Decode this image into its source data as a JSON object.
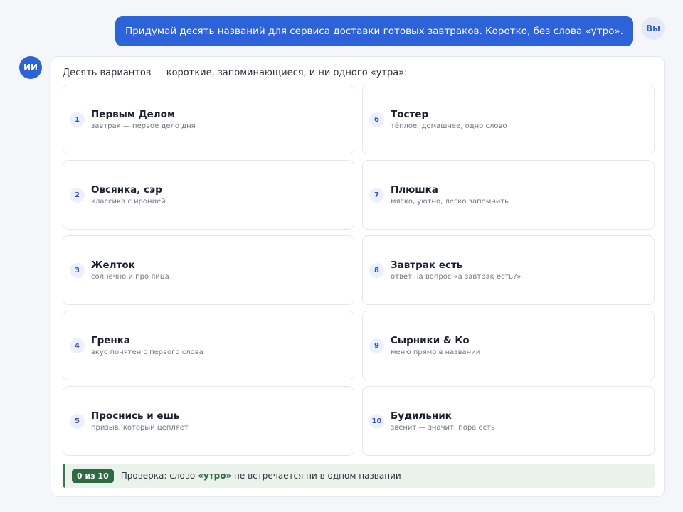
{
  "user": {
    "avatar": "Вы",
    "message": "Придумай десять названий для сервиса доставки готовых завтраков. Коротко, без слова «утро»."
  },
  "assistant": {
    "avatar": "ИИ",
    "intro": "Десять вариантов — короткие, запоминающиеся, и ни одного «утра»:",
    "options": [
      {
        "num": "1",
        "title": "Первым Делом",
        "desc": "завтрак — первое дело дня"
      },
      {
        "num": "2",
        "title": "Овсянка, сэр",
        "desc": "классика с иронией"
      },
      {
        "num": "3",
        "title": "Желток",
        "desc": "солнечно и про яйца"
      },
      {
        "num": "4",
        "title": "Гренка",
        "desc": "вкус понятен с первого слова"
      },
      {
        "num": "5",
        "title": "Проснись и ешь",
        "desc": "призыв, который цепляет"
      },
      {
        "num": "6",
        "title": "Тостер",
        "desc": "тёплое, домашнее, одно слово"
      },
      {
        "num": "7",
        "title": "Плюшка",
        "desc": "мягко, уютно, легко запомнить"
      },
      {
        "num": "8",
        "title": "Завтрак есть",
        "desc": "ответ на вопрос «а завтрак есть?»"
      },
      {
        "num": "9",
        "title": "Сырники & Ко",
        "desc": "меню прямо в названии"
      },
      {
        "num": "10",
        "title": "Будильник",
        "desc": "звенит — значит, пора есть"
      }
    ],
    "check": {
      "badge": "0 из 10",
      "prefix": "Проверка: слово ",
      "word": "«утро»",
      "suffix": " не встречается ни в одном названии"
    }
  },
  "colors": {
    "accent": "#2d63d8",
    "check_green": "#2e6b45",
    "check_bg": "#e9f3ec"
  }
}
